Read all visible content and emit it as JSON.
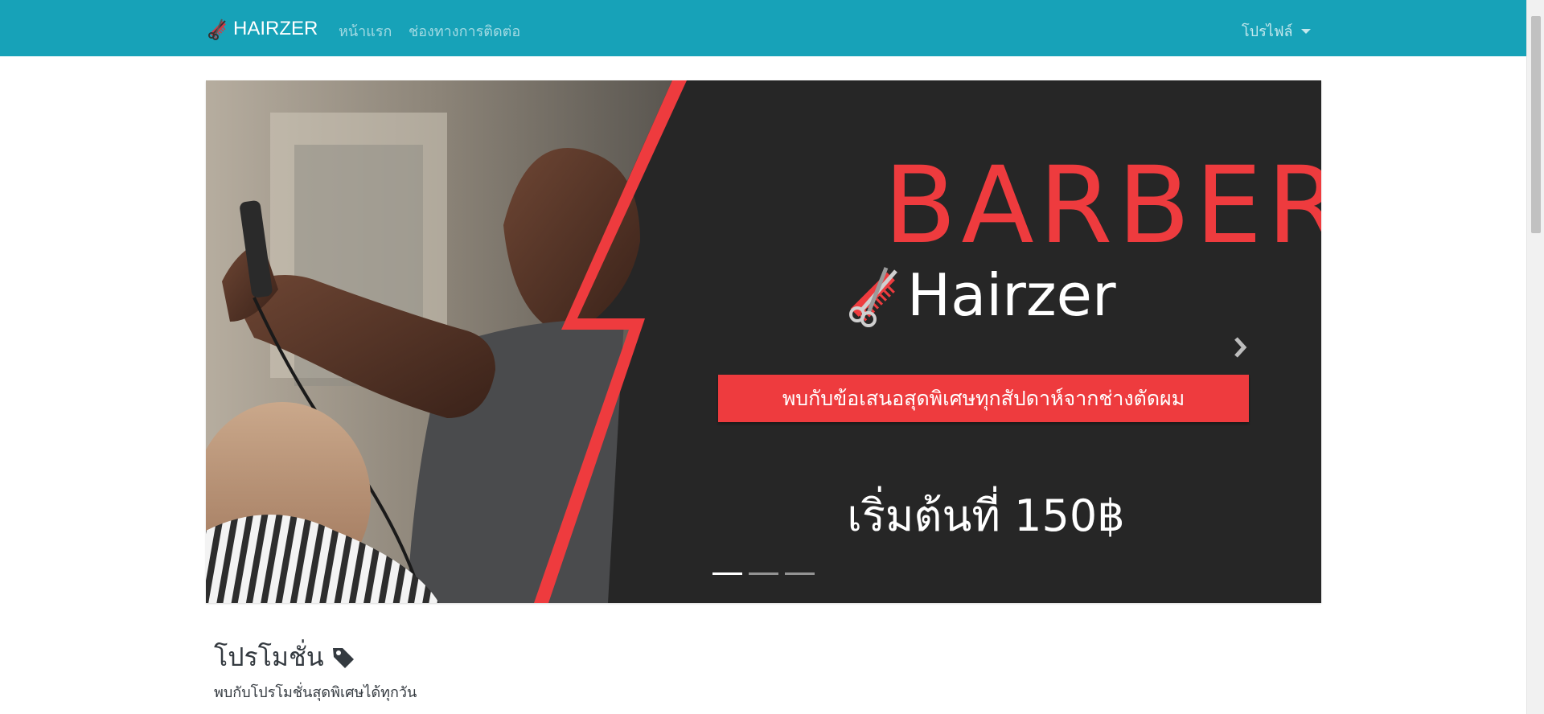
{
  "nav": {
    "brand": "HAIRZER",
    "home": "หน้าแรก",
    "contact": "ช่องทางการติดต่อ",
    "profile": "โปรไฟล์"
  },
  "carousel": {
    "title": "BARBER",
    "logo_text": "Hairzer",
    "offer": "พบกับข้อเสนอสุดพิเศษทุกสัปดาห์จากช่างตัดผม",
    "price": "เริ่มต้นที่ 150฿",
    "slides_count": 3,
    "active_slide": 1
  },
  "promo": {
    "title": "โปรโมชั่น",
    "subtitle": "พบกับโปรโมชั่นสุดพิเศษได้ทุกวัน"
  },
  "colors": {
    "navbar": "#17a2b8",
    "accent_red": "#ee3b3e",
    "banner_dark": "#262626"
  },
  "icons": [
    "scissors-comb-icon",
    "chevron-right-icon",
    "tag-icon",
    "caret-down-icon"
  ]
}
